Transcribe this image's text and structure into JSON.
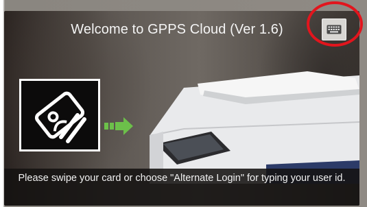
{
  "screen": {
    "title": "Welcome to GPPS Cloud (Ver 1.6)",
    "instructions": "Please swipe your card or choose \"Alternate Login\" for typing your user id."
  },
  "icons": {
    "keyboard": "keyboard-icon",
    "card_swipe": "card-swipe-icon",
    "arrow": "arrow-right-icon",
    "device": "printer-illustration"
  },
  "colors": {
    "annotation": "#e2151d",
    "arrow": "#6cc04a",
    "title_text": "#f4f4f4"
  }
}
